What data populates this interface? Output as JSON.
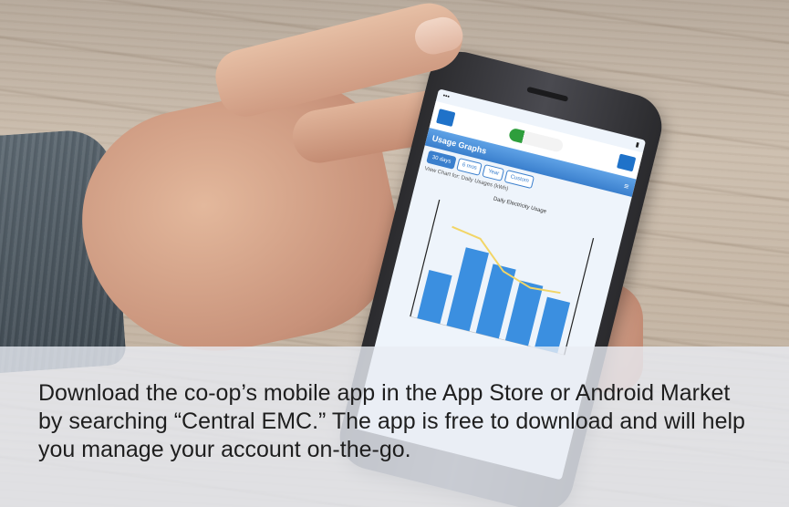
{
  "caption": {
    "text": "Download the co-op’s mobile app in the App Store or Android Market by searching “Central EMC.” The app is free to download and will help you manage your account on-the-go."
  },
  "phone_screen": {
    "title": "Usage Graphs",
    "tabs": [
      "30 days",
      "6 mos",
      "Year",
      "Custom"
    ],
    "view_label": "View Chart for:",
    "view_value": "Daily Usages (kWh)",
    "chart_title": "Daily Electricity Usage"
  },
  "colors": {
    "brand_blue": "#3a7fcd",
    "bar_blue": "#3b8fe0",
    "line_yellow": "#f2d566",
    "caption_panel": "#e9ecf4"
  },
  "chart_data": {
    "type": "bar",
    "categories": [
      "",
      "",
      "",
      "",
      ""
    ],
    "values": [
      0.42,
      0.68,
      0.6,
      0.52,
      0.44
    ],
    "line_values": [
      0.82,
      0.78,
      0.56,
      0.48,
      0.5
    ]
  }
}
